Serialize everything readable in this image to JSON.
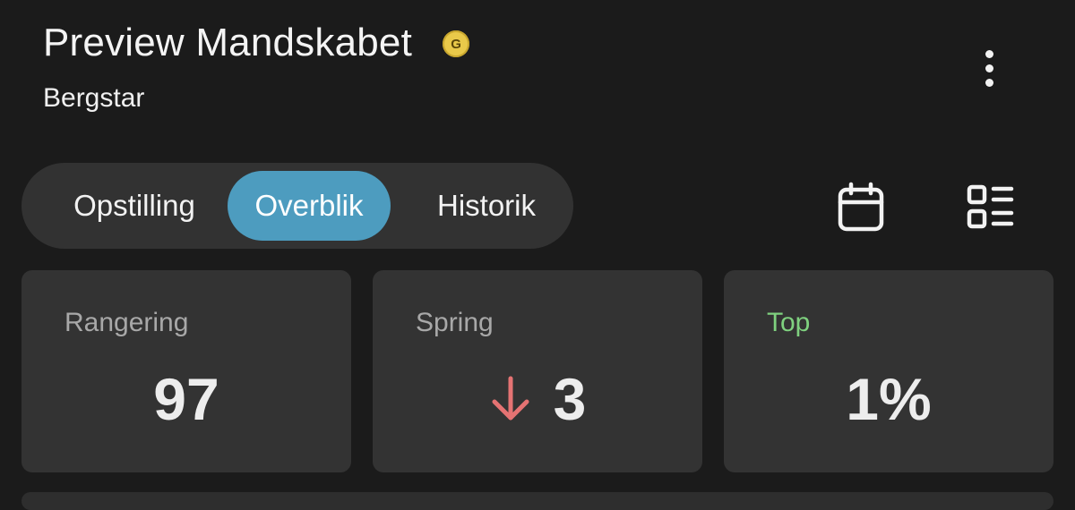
{
  "header": {
    "title": "Preview Mandskabet",
    "badge": "G",
    "subtitle": "Bergstar"
  },
  "tabs": [
    {
      "label": "Opstilling",
      "active": false
    },
    {
      "label": "Overblik",
      "active": true
    },
    {
      "label": "Historik",
      "active": false
    }
  ],
  "actions": {
    "calendar_icon": "calendar-icon",
    "list_view_icon": "list-view-icon",
    "menu_icon": "more-vert-icon"
  },
  "stats": [
    {
      "label": "Rangering",
      "value": "97"
    },
    {
      "label": "Spring",
      "value": "3",
      "direction": "down",
      "direction_color": "#e57373"
    },
    {
      "label": "Top",
      "value": "1%",
      "label_color": "#7fd17f"
    }
  ],
  "colors": {
    "accent": "#4d9cbf",
    "background": "#1b1b1b",
    "card": "#333333"
  }
}
